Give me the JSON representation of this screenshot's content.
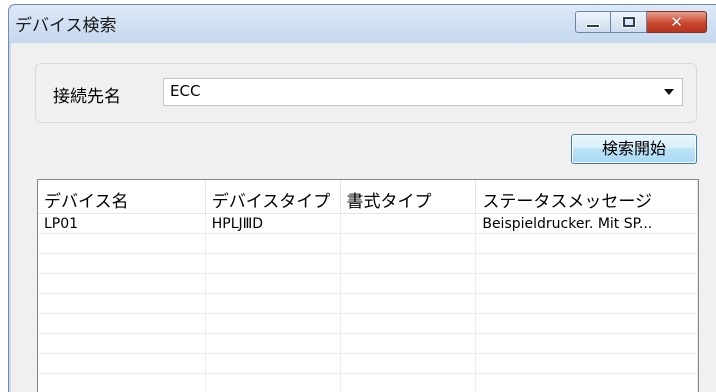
{
  "window": {
    "title": "デバイス検索"
  },
  "connection": {
    "label": "接続先名",
    "selected_value": "ECC"
  },
  "search_button": {
    "label": "検索開始"
  },
  "table": {
    "columns": [
      "デバイス名",
      "デバイスタイプ",
      "書式タイプ",
      "ステータスメッセージ"
    ],
    "rows": [
      [
        "LP01",
        "HPLJⅢD",
        "",
        "Beispieldrucker. Mit SP..."
      ]
    ]
  },
  "icons": {
    "minimize": "minimize-icon",
    "maximize": "maximize-icon",
    "close": "close-icon",
    "dropdown": "chevron-down-icon"
  },
  "colors": {
    "titlebar": "#c5d8ee",
    "close_button": "#c9472e",
    "button_accent": "#bde3f6"
  }
}
